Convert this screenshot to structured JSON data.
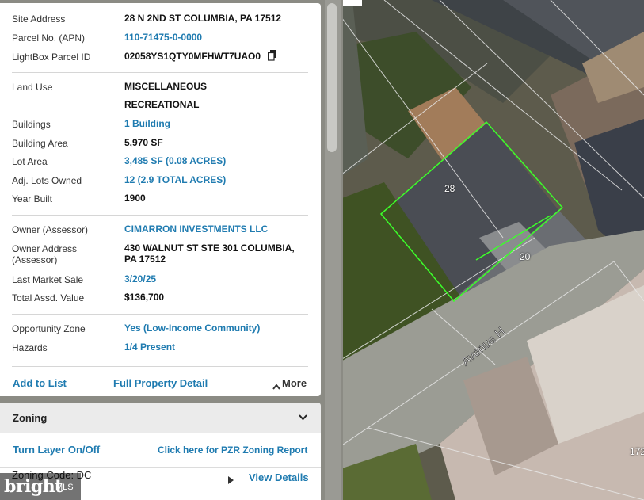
{
  "property": {
    "rows_top": [
      {
        "label": "Site Address",
        "value": "28 N 2ND ST COLUMBIA, PA 17512",
        "link": false
      },
      {
        "label": "Parcel No. (APN)",
        "value": "110-71475-0-0000",
        "link": true
      },
      {
        "label": "LightBox Parcel ID",
        "value": "02058YS1QTY0MFHWT7UAO0",
        "link": false
      }
    ],
    "land_use_label": "Land Use",
    "land_use_line1": "MISCELLANEOUS",
    "land_use_line2": "RECREATIONAL",
    "rows_mid": [
      {
        "label": "Buildings",
        "value": "1 Building",
        "link": true
      },
      {
        "label": "Building Area",
        "value": "5,970 SF",
        "link": false
      },
      {
        "label": "Lot Area",
        "value": "3,485 SF (0.08 ACRES)",
        "link": true
      },
      {
        "label": "Adj. Lots Owned",
        "value": "12 (2.9 TOTAL ACRES)",
        "link": true
      },
      {
        "label": "Year Built",
        "value": "1900",
        "link": false
      }
    ],
    "owner_label": "Owner (Assessor)",
    "owner_value": "CIMARRON INVESTMENTS LLC",
    "owner_addr_label1": "Owner Address",
    "owner_addr_label2": "(Assessor)",
    "owner_addr_line1": "430 WALNUT ST STE 301 COLUMBIA,",
    "owner_addr_line2": "PA 17512",
    "last_sale_label": "Last Market Sale",
    "last_sale_value": "3/20/25",
    "assd_label": "Total Assd. Value",
    "assd_value": "$136,700",
    "opp_label": "Opportunity Zone",
    "opp_value": "Yes (Low-Income Community)",
    "haz_label": "Hazards",
    "haz_value": "1/4 Present"
  },
  "actions": {
    "add_to_list": "Add to List",
    "full_detail": "Full Property Detail",
    "more": "More"
  },
  "zoning": {
    "title": "Zoning",
    "toggle_layer": "Turn Layer On/Off",
    "pzr_report": "Click here for PZR Zoning Report",
    "zoning_code_partial": "Zoning Code: DC",
    "view_details": "View Details"
  },
  "map": {
    "parcel_label_1": "28",
    "parcel_label_2": "20",
    "street_label": "Avenue H",
    "edge_number": "172"
  },
  "branding": {
    "logo": "bright",
    "logo_suffix": "MLS"
  },
  "colors": {
    "link": "#1f7bb0",
    "parcel_outline": "#3cff2a"
  }
}
